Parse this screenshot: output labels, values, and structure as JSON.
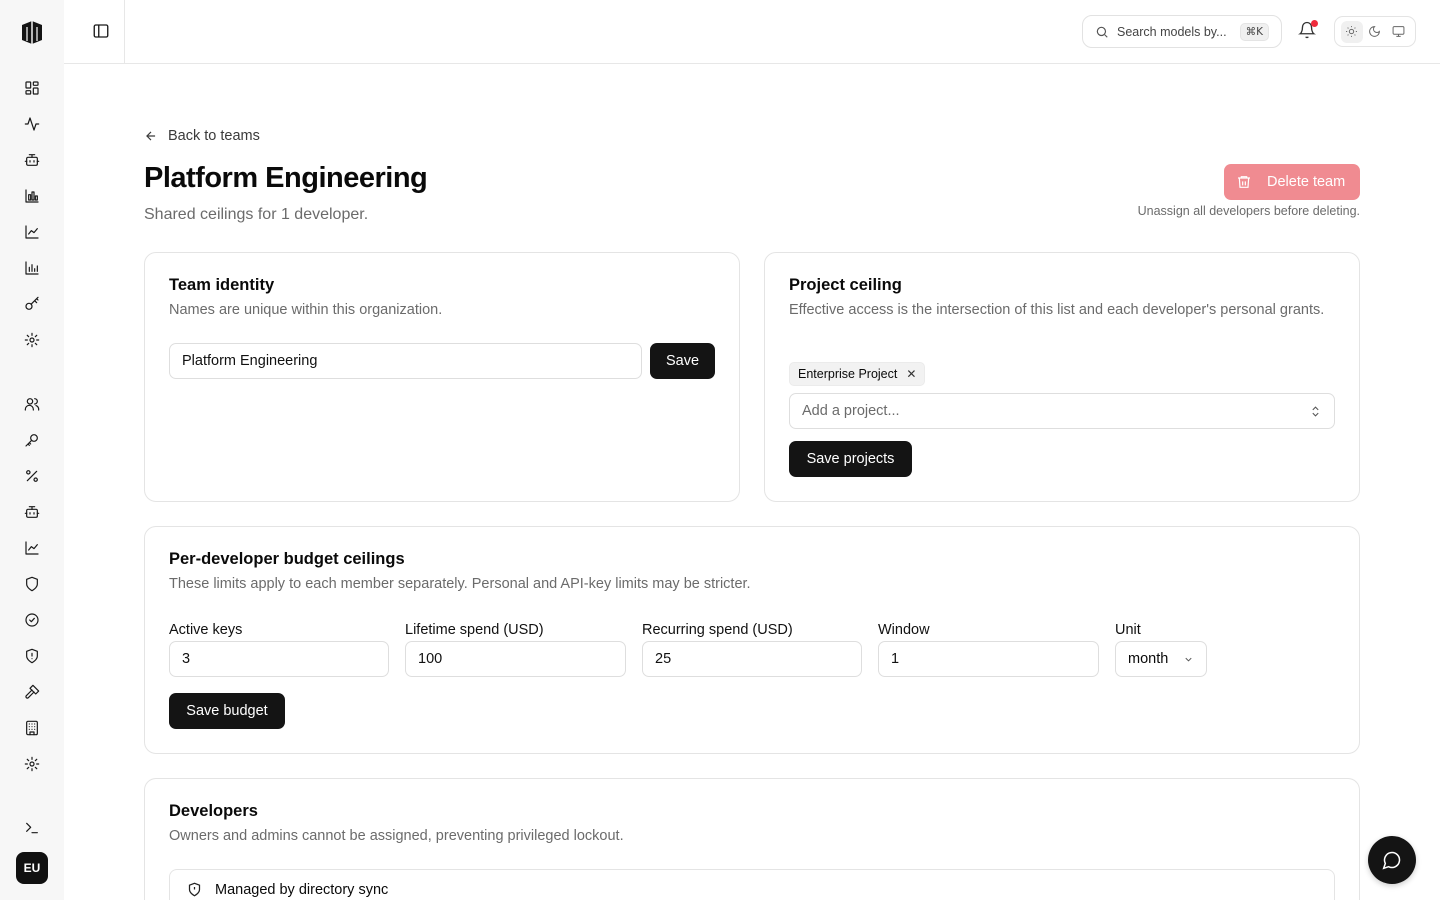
{
  "user": {
    "initials": "EU"
  },
  "rail": {
    "items": [
      {
        "name": "dashboard-icon"
      },
      {
        "name": "activity-icon"
      },
      {
        "name": "bot-icon"
      },
      {
        "name": "bar-chart-icon"
      },
      {
        "name": "line-chart-icon"
      },
      {
        "name": "column-chart-icon"
      },
      {
        "name": "key-icon"
      },
      {
        "name": "settings-icon"
      },
      {
        "name": "users-icon"
      },
      {
        "name": "key-round-icon"
      },
      {
        "name": "percent-icon"
      },
      {
        "name": "bot-icon"
      },
      {
        "name": "trend-chart-icon"
      },
      {
        "name": "shield-icon"
      },
      {
        "name": "badge-check-icon"
      },
      {
        "name": "shield-alert-icon"
      },
      {
        "name": "hammer-icon"
      },
      {
        "name": "building-icon"
      },
      {
        "name": "settings-icon"
      },
      {
        "name": "terminal-icon"
      }
    ]
  },
  "topbar": {
    "search_placeholder": "Search models by...",
    "search_shortcut": "⌘K",
    "notification_dot_color": "#ef2b3c"
  },
  "header": {
    "back_label": "Back to teams",
    "title": "Platform Engineering",
    "subtitle": "Shared ceilings for 1 developer.",
    "delete_label": "Delete team",
    "delete_note": "Unassign all developers before deleting."
  },
  "identity": {
    "title": "Team identity",
    "description": "Names are unique within this organization.",
    "name_value": "Platform Engineering",
    "save_label": "Save"
  },
  "projects": {
    "title": "Project ceiling",
    "description": "Effective access is the intersection of this list and each developer's personal grants.",
    "chips": [
      "Enterprise Project"
    ],
    "add_placeholder": "Add a project...",
    "save_label": "Save projects"
  },
  "budget": {
    "title": "Per-developer budget ceilings",
    "description": "These limits apply to each member separately. Personal and API-key limits may be stricter.",
    "fields": {
      "active_keys": {
        "label": "Active keys",
        "value": "3"
      },
      "lifetime_spend": {
        "label": "Lifetime spend (USD)",
        "value": "100"
      },
      "recurring_spend": {
        "label": "Recurring spend (USD)",
        "value": "25"
      },
      "window": {
        "label": "Window",
        "value": "1"
      },
      "unit": {
        "label": "Unit",
        "value": "month"
      }
    },
    "save_label": "Save budget"
  },
  "developers": {
    "title": "Developers",
    "description": "Owners and admins cannot be assigned, preventing privileged lockout.",
    "directory_sync_label": "Managed by directory sync"
  },
  "colors": {
    "accent": "#141414",
    "danger_disabled": "#f08b91"
  }
}
